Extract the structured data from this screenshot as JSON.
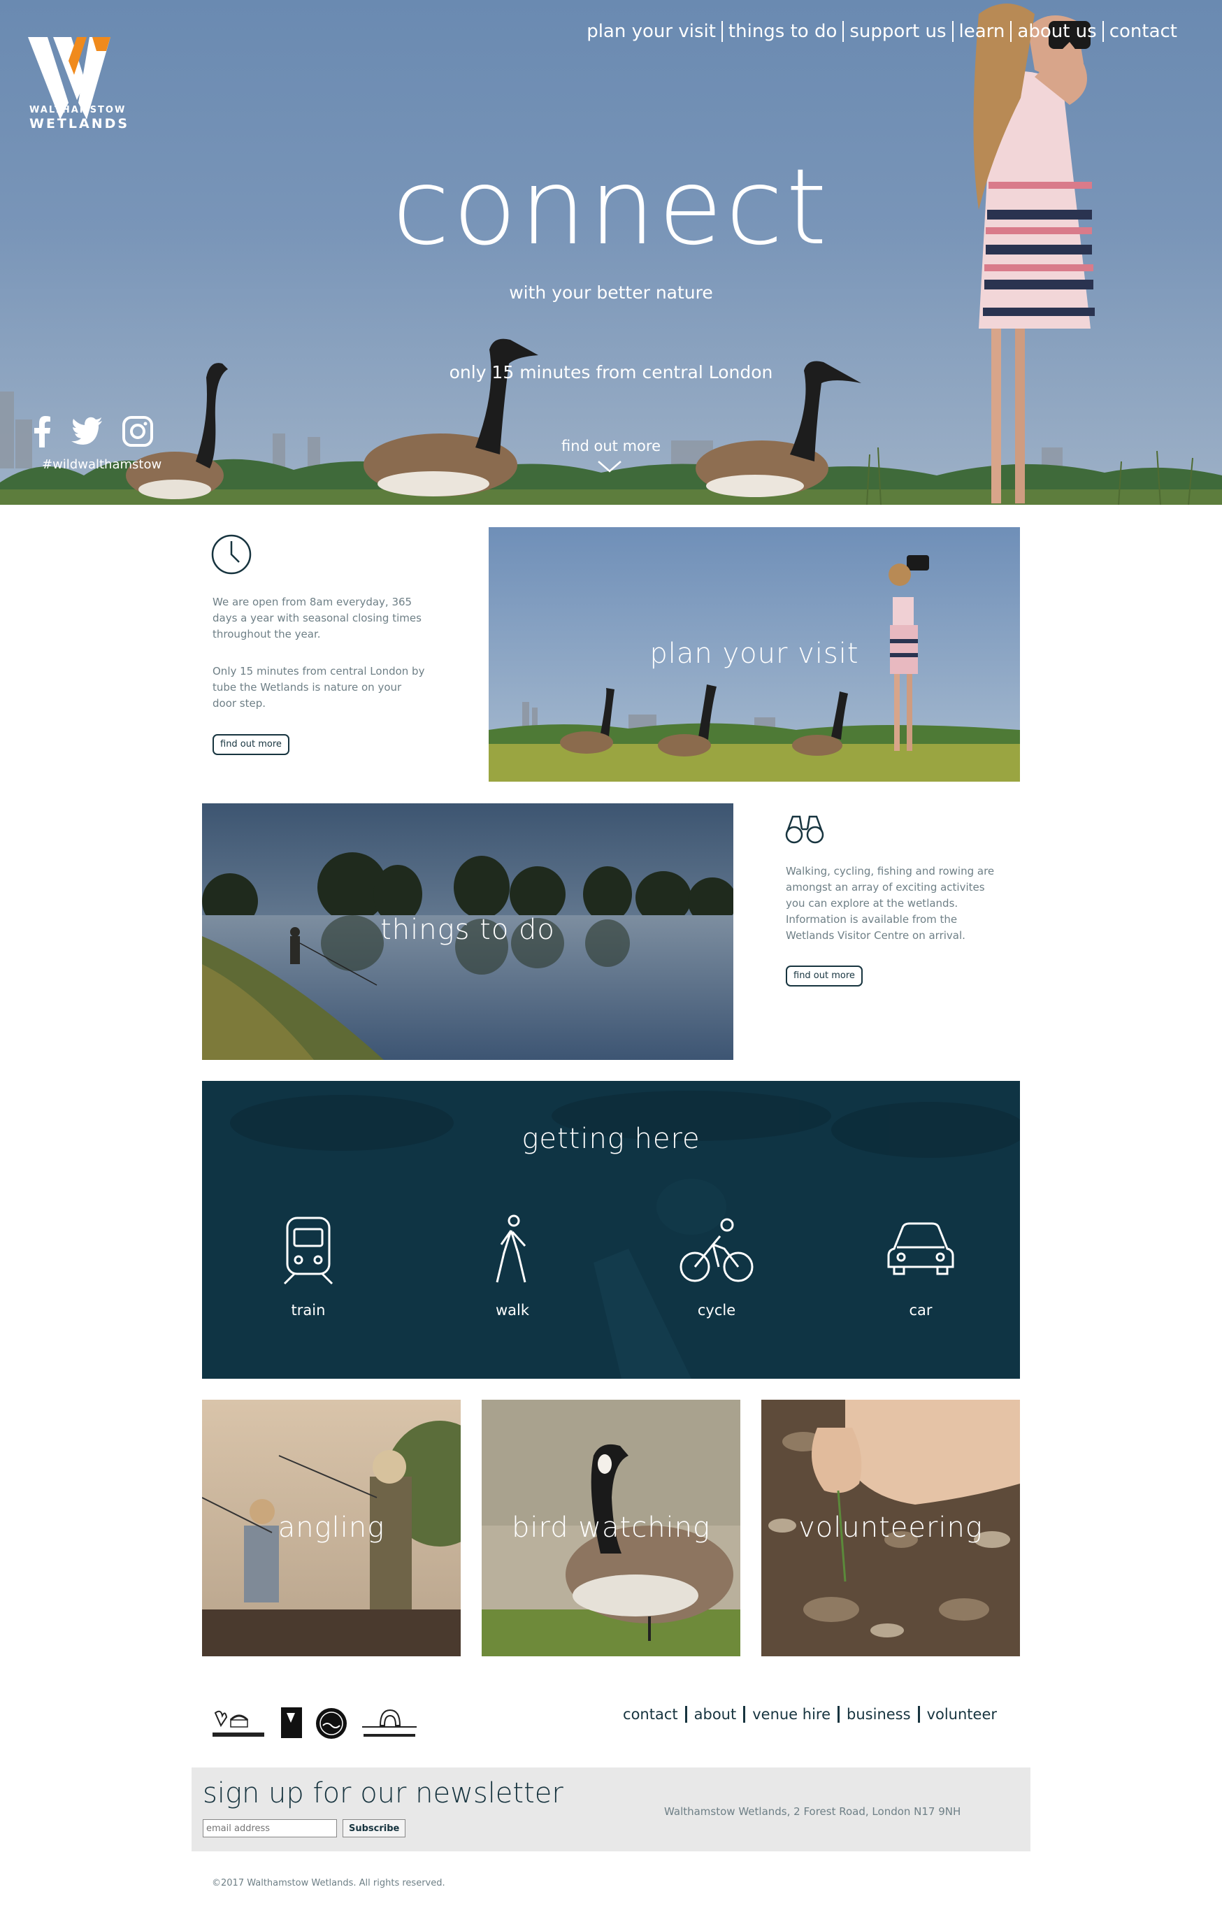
{
  "brand": {
    "logo_line1": "WALTHAMSTOW",
    "logo_line2": "WETLANDS",
    "colors": {
      "logo_white": "#ffffff",
      "logo_orange": "#f08a1c",
      "dark_teal": "#0f3444",
      "text_grey": "#6e7f86"
    }
  },
  "nav": {
    "items": [
      "plan your visit",
      "things to do",
      "support us",
      "learn",
      "about us",
      "contact"
    ]
  },
  "hero": {
    "title": "connect",
    "subtitle": "with your better nature",
    "tagline": "only 15 minutes from central London",
    "cta": "find out more",
    "hashtag": "#wildwalthamstow",
    "social_icons": [
      "facebook-icon",
      "twitter-icon",
      "instagram-icon"
    ]
  },
  "visit": {
    "icon": "clock-icon",
    "para1": [
      "We are open from 8am everyday, 365",
      "days a year with seasonal closing times",
      "throughout the year."
    ],
    "para2": [
      "Only 15 minutes from central London by",
      "tube the Wetlands is nature on your",
      "door step."
    ],
    "button": "find out more",
    "photo_label": "plan your visit"
  },
  "things": {
    "icon": "binoculars-icon",
    "para": [
      "Walking, cycling, fishing and rowing are",
      "amongst an array of exciting activites",
      "you can explore at the wetlands.",
      "Information is available from the",
      "Wetlands Visitor Centre on arrival."
    ],
    "button": "find out more",
    "photo_label": "things to do"
  },
  "getting_here": {
    "title": "getting here",
    "items": [
      {
        "label": "train",
        "icon": "train-icon"
      },
      {
        "label": "walk",
        "icon": "walking-person-icon"
      },
      {
        "label": "cycle",
        "icon": "bicycle-icon"
      },
      {
        "label": "car",
        "icon": "car-icon"
      }
    ]
  },
  "tiles": [
    {
      "label": "angling"
    },
    {
      "label": "bird watching"
    },
    {
      "label": "volunteering"
    }
  ],
  "footer": {
    "partners": [
      "heritage-lottery-logo",
      "london-wildlife-trust-logo",
      "thames-water-logo",
      "waltham-forest-logo"
    ],
    "nav": [
      "contact",
      "about",
      "venue hire",
      "business",
      "volunteer"
    ],
    "newsletter_title": "sign up for our newsletter",
    "email_placeholder": "email address",
    "subscribe": "Subscribe",
    "address": "Walthamstow Wetlands, 2 Forest Road, London N17 9NH",
    "copyright": "©2017 Walthamstow Wetlands. All rights reserved."
  }
}
